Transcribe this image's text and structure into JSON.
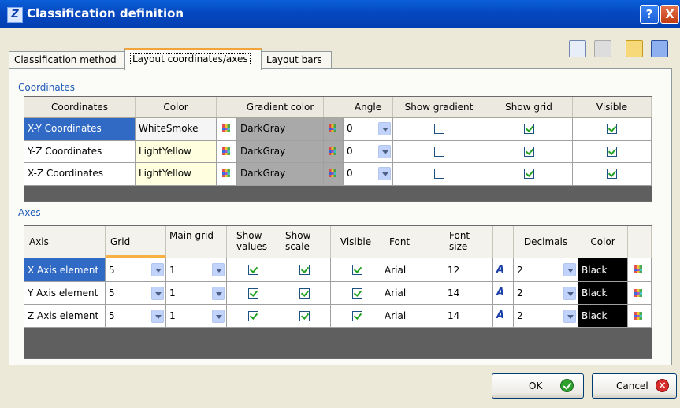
{
  "window": {
    "title": "Classification definition",
    "help_label": "?",
    "close_label": "X"
  },
  "tabs": [
    {
      "label": "Classification method"
    },
    {
      "label": "Layout coordinates/axes"
    },
    {
      "label": "Layout bars"
    }
  ],
  "toolbar_icons": [
    "layout-icon",
    "print-icon",
    "open-folder-icon",
    "save-icon"
  ],
  "coordinates": {
    "section_label": "Coordinates",
    "headers": [
      "Coordinates",
      "Color",
      "",
      "Gradient color",
      "",
      "Angle",
      "Show gradient",
      "Show grid",
      "Visible"
    ],
    "rows": [
      {
        "name": "X-Y Coordinates",
        "color": "WhiteSmoke",
        "gradient": "DarkGray",
        "angle": "0",
        "show_gradient": false,
        "show_grid": true,
        "visible": true
      },
      {
        "name": "Y-Z Coordinates",
        "color": "LightYellow",
        "gradient": "DarkGray",
        "angle": "0",
        "show_gradient": false,
        "show_grid": true,
        "visible": true
      },
      {
        "name": "X-Z Coordinates",
        "color": "LightYellow",
        "gradient": "DarkGray",
        "angle": "0",
        "show_gradient": false,
        "show_grid": true,
        "visible": true
      }
    ]
  },
  "axes": {
    "section_label": "Axes",
    "headers": {
      "axis": "Axis",
      "grid": "Grid",
      "main_grid": "Main grid",
      "show_values": "Show values",
      "show_scale": "Show scale",
      "visible": "Visible",
      "font": "Font",
      "font_size": "Font size",
      "decimals": "Decimals",
      "color": "Color"
    },
    "rows": [
      {
        "name": "X Axis element",
        "grid": "5",
        "main_grid": "1",
        "show_values": true,
        "show_scale": true,
        "visible": true,
        "font": "Arial",
        "font_size": "12",
        "decimals": "2",
        "color": "Black"
      },
      {
        "name": "Y Axis element",
        "grid": "5",
        "main_grid": "1",
        "show_values": true,
        "show_scale": true,
        "visible": true,
        "font": "Arial",
        "font_size": "14",
        "decimals": "2",
        "color": "Black"
      },
      {
        "name": "Z Axis element",
        "grid": "5",
        "main_grid": "1",
        "show_values": true,
        "show_scale": true,
        "visible": true,
        "font": "Arial",
        "font_size": "14",
        "decimals": "2",
        "color": "Black"
      }
    ]
  },
  "buttons": {
    "ok": "OK",
    "cancel": "Cancel"
  },
  "colors": {
    "titlebar": "#0548c0",
    "selection": "#316ac5",
    "section_label": "#1d5bb8",
    "grid_background": "#5f5f5f"
  }
}
